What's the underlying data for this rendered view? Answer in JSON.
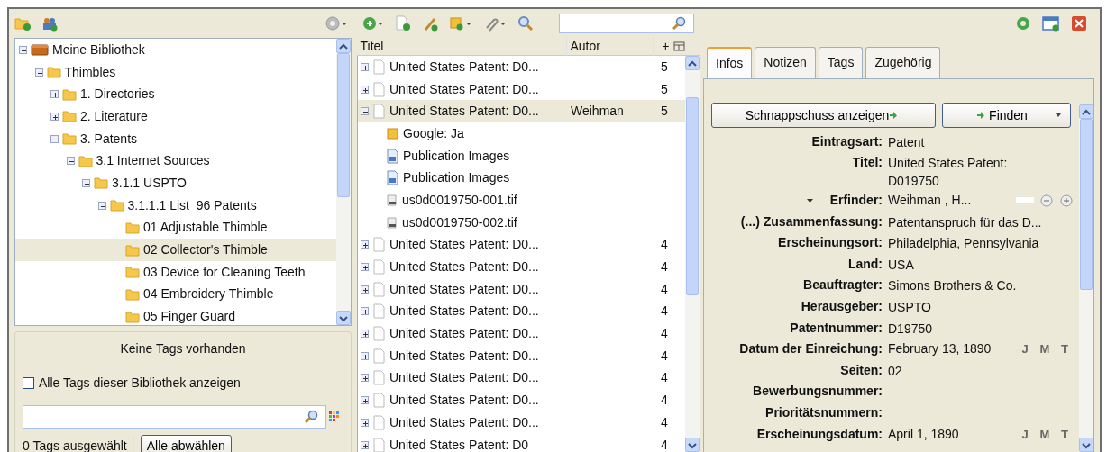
{
  "collections": [
    {
      "label": "Meine Bibliothek",
      "kind": "library",
      "expandable": true,
      "expanded": true,
      "selected": false,
      "children": [
        {
          "label": "Thimbles",
          "kind": "folder",
          "expandable": true,
          "expanded": true,
          "selected": false,
          "children": [
            {
              "label": "1.  Directories",
              "kind": "folder",
              "expandable": true,
              "expanded": false,
              "selected": false
            },
            {
              "label": "2. Literature",
              "kind": "folder",
              "expandable": true,
              "expanded": false,
              "selected": false
            },
            {
              "label": "3. Patents",
              "kind": "folder",
              "expandable": true,
              "expanded": true,
              "selected": false,
              "children": [
                {
                  "label": "3.1 Internet Sources",
                  "kind": "folder",
                  "expandable": true,
                  "expanded": true,
                  "selected": false,
                  "children": [
                    {
                      "label": "3.1.1  USPTO",
                      "kind": "folder",
                      "expandable": true,
                      "expanded": true,
                      "selected": false,
                      "children": [
                        {
                          "label": "3.1.1.1  List_96 Patents",
                          "kind": "folder",
                          "expandable": true,
                          "expanded": true,
                          "selected": false,
                          "children": [
                            {
                              "label": "01 Adjustable Thimble",
                              "kind": "folder",
                              "expandable": false,
                              "selected": false
                            },
                            {
                              "label": "02 Collector's Thimble",
                              "kind": "folder",
                              "expandable": false,
                              "selected": true
                            },
                            {
                              "label": "03 Device for Cleaning Teeth",
                              "kind": "folder",
                              "expandable": false,
                              "selected": false
                            },
                            {
                              "label": "04 Embroidery Thimble",
                              "kind": "folder",
                              "expandable": false,
                              "selected": false
                            },
                            {
                              "label": "05 Finger Guard",
                              "kind": "folder",
                              "expandable": false,
                              "selected": false
                            }
                          ]
                        }
                      ]
                    }
                  ]
                }
              ]
            }
          ]
        }
      ]
    }
  ],
  "tags": {
    "empty_message": "Keine Tags vorhanden",
    "show_all": {
      "label": "Alle Tags dieser Bibliothek anzeigen",
      "checked": false
    },
    "selected_count": "0 Tags ausgewählt",
    "deselect_button": "Alle abwählen"
  },
  "items": {
    "columns": [
      "Titel",
      "Autor",
      "+"
    ],
    "rows": [
      {
        "kind": "item",
        "expanded": false,
        "title": "United States Patent: D0...",
        "count": "5",
        "selected": false
      },
      {
        "kind": "item",
        "expanded": false,
        "title": "United States Patent: D0...",
        "count": "5",
        "selected": false
      },
      {
        "kind": "item",
        "expanded": true,
        "title": "United States Patent: D0...",
        "author": "Weihman",
        "count": "5",
        "selected": true
      },
      {
        "kind": "snapshot",
        "title": "Google: Ja",
        "selected": false
      },
      {
        "kind": "image",
        "title": "Publication Images",
        "selected": false
      },
      {
        "kind": "image",
        "title": "Publication Images",
        "selected": false
      },
      {
        "kind": "file",
        "title": "us0d0019750-001.tif",
        "selected": false
      },
      {
        "kind": "file",
        "title": "us0d0019750-002.tif",
        "selected": false
      },
      {
        "kind": "item",
        "expanded": false,
        "title": "United States Patent: D0...",
        "count": "4",
        "selected": false
      },
      {
        "kind": "item",
        "expanded": false,
        "title": "United States Patent: D0...",
        "count": "4",
        "selected": false
      },
      {
        "kind": "item",
        "expanded": false,
        "title": "United States Patent: D0...",
        "count": "4",
        "selected": false
      },
      {
        "kind": "item",
        "expanded": false,
        "title": "United States Patent: D0...",
        "count": "4",
        "selected": false
      },
      {
        "kind": "item",
        "expanded": false,
        "title": "United States Patent: D0...",
        "count": "4",
        "selected": false
      },
      {
        "kind": "item",
        "expanded": false,
        "title": "United States Patent: D0...",
        "count": "4",
        "selected": false
      },
      {
        "kind": "item",
        "expanded": false,
        "title": "United States Patent: D0...",
        "count": "4",
        "selected": false
      },
      {
        "kind": "item",
        "expanded": false,
        "title": "United States Patent: D0...",
        "count": "4",
        "selected": false
      },
      {
        "kind": "item",
        "expanded": false,
        "title": "United States Patent: D0...",
        "count": "4",
        "selected": false
      },
      {
        "kind": "item",
        "expanded": false,
        "title": "United States Patent: D0",
        "count": "4",
        "selected": false
      }
    ]
  },
  "detail": {
    "tabs": [
      {
        "label": "Infos",
        "selected": true
      },
      {
        "label": "Notizen",
        "selected": false
      },
      {
        "label": "Tags",
        "selected": false
      },
      {
        "label": "Zugehörig",
        "selected": false
      }
    ],
    "snapshot_button": "Schnappschuss anzeigen",
    "find_button": "Finden",
    "fields": [
      {
        "kind": "plain",
        "label": "Eintragsart:",
        "value": "Patent"
      },
      {
        "kind": "plain",
        "label": "Titel:",
        "value": "United States Patent: D019750"
      },
      {
        "kind": "creator",
        "label": "Erfinder:",
        "value": "Weihman  , H..."
      },
      {
        "kind": "plain",
        "label": "(...) Zusammenfassung:",
        "value": "Patentanspruch für das D..."
      },
      {
        "kind": "plain",
        "label": "Erscheinungsort:",
        "value": "Philadelphia, Pennsylvania"
      },
      {
        "kind": "plain",
        "label": "Land:",
        "value": "USA"
      },
      {
        "kind": "plain",
        "label": "Beauftragter:",
        "value": "Simons Brothers & Co."
      },
      {
        "kind": "plain",
        "label": "Herausgeber:",
        "value": "USPTO"
      },
      {
        "kind": "plain",
        "label": "Patentnummer:",
        "value": "D19750"
      },
      {
        "kind": "date",
        "label": "Datum der Einreichung:",
        "value": "February 13, 1890",
        "date_order": "J M T"
      },
      {
        "kind": "plain",
        "label": "Seiten:",
        "value": "02"
      },
      {
        "kind": "plain",
        "label": "Bewerbungsnummer:"
      },
      {
        "kind": "plain",
        "label": "Prioritätsnummern:"
      },
      {
        "kind": "date",
        "label": "Erscheinungsdatum:",
        "value": "April 1, 1890",
        "date_order": "J M T"
      }
    ]
  }
}
